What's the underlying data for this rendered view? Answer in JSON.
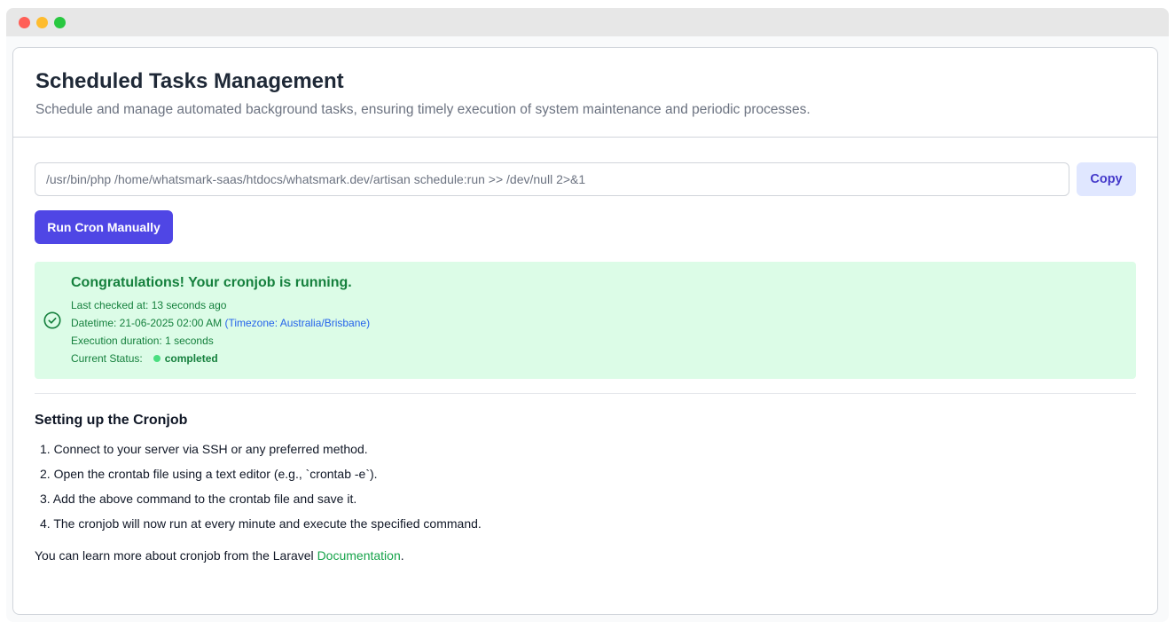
{
  "header": {
    "title": "Scheduled Tasks Management",
    "subtitle": "Schedule and manage automated background tasks, ensuring timely execution of system maintenance and periodic processes."
  },
  "command": {
    "value": "/usr/bin/php /home/whatsmark-saas/htdocs/whatsmark.dev/artisan schedule:run >> /dev/null 2>&1",
    "copy_label": "Copy"
  },
  "run_button": {
    "label": "Run Cron Manually"
  },
  "status_alert": {
    "icon": "check-circle-icon",
    "title": "Congratulations! Your cronjob is running.",
    "last_checked": "Last checked at: 13 seconds ago",
    "datetime": "Datetime: 21-06-2025 02:00 AM",
    "timezone": "(Timezone: Australia/Brisbane)",
    "duration": "Execution duration: 1 seconds",
    "status_label": "Current Status:",
    "status_value": "completed",
    "status_color": "#4ade80"
  },
  "setup": {
    "title": "Setting up the Cronjob",
    "steps": [
      "1. Connect to your server via SSH or any preferred method.",
      "2. Open the crontab file using a text editor (e.g., `crontab -e`).",
      "3. Add the above command to the crontab file and save it.",
      "4. The cronjob will now run at every minute and execute the specified command."
    ],
    "learn_prefix": "You can learn more about cronjob from the Laravel ",
    "learn_link": "Documentation",
    "learn_suffix": "."
  },
  "colors": {
    "primary": "#4f46e5",
    "success_bg": "#dcfce7",
    "success_text": "#15803d",
    "link": "#16a34a"
  }
}
